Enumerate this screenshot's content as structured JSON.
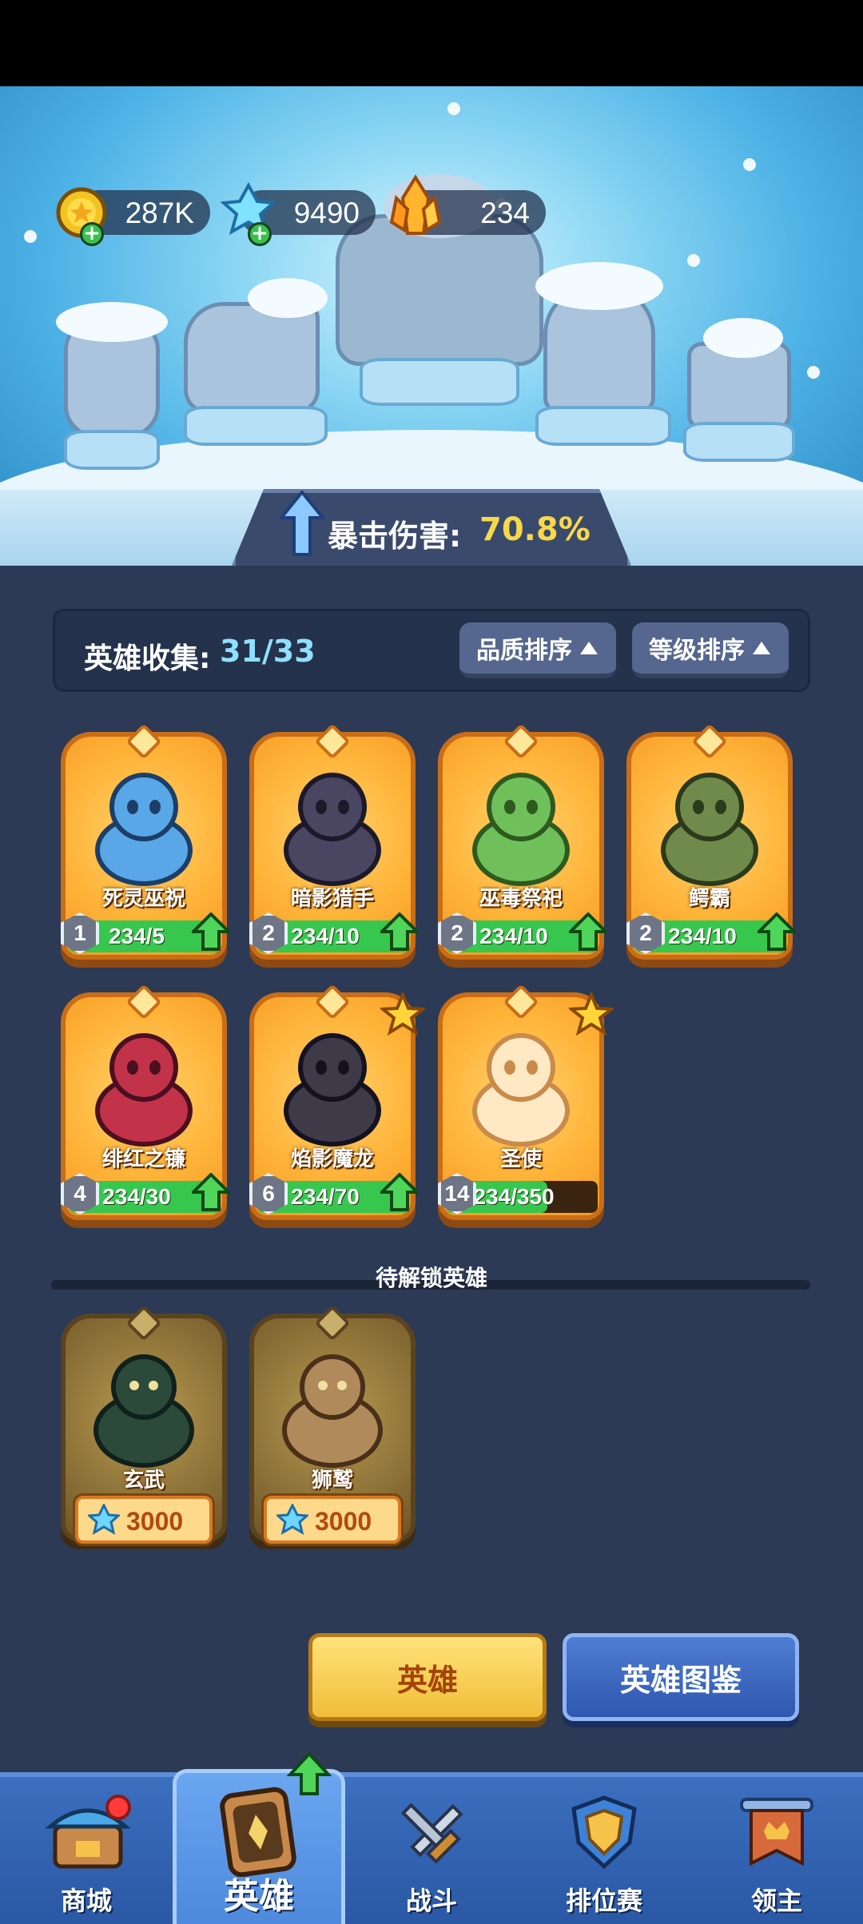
{
  "resources": {
    "gold": {
      "amount": "287K",
      "icon": "gold-coin-icon"
    },
    "ice_crystal": {
      "amount": "9490",
      "icon": "ice-crystal-icon"
    },
    "orange_crystal": {
      "amount": "234",
      "icon": "orange-crystal-icon"
    }
  },
  "crit": {
    "label": "暴击伤害:",
    "value": "70.8%"
  },
  "collection": {
    "label": "英雄收集:",
    "count": "31/33"
  },
  "sort": {
    "quality_label": "品质排序",
    "level_label": "等级排序"
  },
  "heroes": [
    {
      "name": "死灵巫祝",
      "level": "1",
      "progress": "234/5",
      "fill": 1.0,
      "upgradable": true,
      "star": false
    },
    {
      "name": "暗影猎手",
      "level": "2",
      "progress": "234/10",
      "fill": 1.0,
      "upgradable": true,
      "star": false
    },
    {
      "name": "巫毒祭祀",
      "level": "2",
      "progress": "234/10",
      "fill": 1.0,
      "upgradable": true,
      "star": false
    },
    {
      "name": "鳄霸",
      "level": "2",
      "progress": "234/10",
      "fill": 1.0,
      "upgradable": true,
      "star": false
    },
    {
      "name": "绯红之镰",
      "level": "4",
      "progress": "234/30",
      "fill": 1.0,
      "upgradable": true,
      "star": false
    },
    {
      "name": "焰影魔龙",
      "level": "6",
      "progress": "234/70",
      "fill": 1.0,
      "upgradable": true,
      "star": true
    },
    {
      "name": "圣使",
      "level": "14",
      "progress": "234/350",
      "fill": 0.67,
      "upgradable": false,
      "star": true
    }
  ],
  "locked_section_label": "待解锁英雄",
  "locked_heroes": [
    {
      "name": "玄武",
      "price": "3000"
    },
    {
      "name": "狮鹫",
      "price": "3000"
    }
  ],
  "buttons": {
    "hero": "英雄",
    "codex": "英雄图鉴"
  },
  "nav": [
    {
      "label": "商城",
      "icon": "shop-icon"
    },
    {
      "label": "英雄",
      "icon": "hero-card-icon"
    },
    {
      "label": "战斗",
      "icon": "crossed-swords-icon"
    },
    {
      "label": "排位赛",
      "icon": "rank-shield-icon"
    },
    {
      "label": "领主",
      "icon": "lord-banner-icon"
    }
  ],
  "colors": {
    "accent_gold": "#f7d84a",
    "accent_cyan": "#8fe0ff",
    "progress_green": "#37c64e",
    "card_orange": "#ffb43a"
  }
}
